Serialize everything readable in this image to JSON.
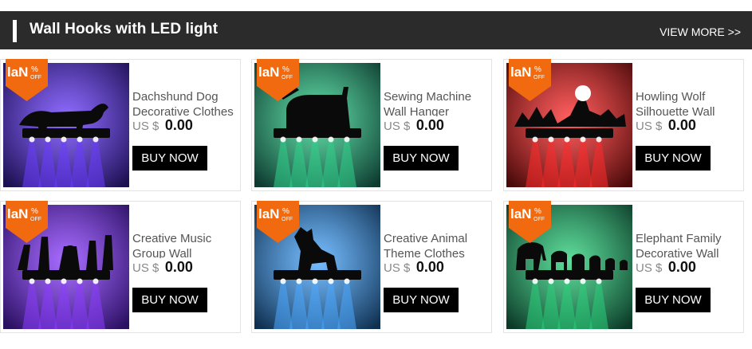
{
  "header": {
    "title": "Wall Hooks with LED light",
    "view_more": "VIEW MORE >>"
  },
  "badge": {
    "brand": "laN",
    "percent": "%",
    "off": "OFF",
    "color": "#f26a10"
  },
  "products": [
    {
      "name": "Dachshund Dog Decorative Clothes",
      "currency": "US $",
      "price": "0.00",
      "buy": "BUY NOW",
      "glow": "#6a3cff",
      "bg": "#1c1050",
      "silhouette": "dog"
    },
    {
      "name": "Sewing Machine Wall Hanger",
      "currency": "US $",
      "price": "0.00",
      "buy": "BUY NOW",
      "glow": "#2fd08a",
      "bg": "#0e3a30",
      "silhouette": "sewing-machine"
    },
    {
      "name": "Howling Wolf Silhouette Wall",
      "currency": "US $",
      "price": "0.00",
      "buy": "BUY NOW",
      "glow": "#ff2a2a",
      "bg": "#4a0a0a",
      "silhouette": "wolf"
    },
    {
      "name": "Creative Music Group Wall",
      "currency": "US $",
      "price": "0.00",
      "buy": "BUY NOW",
      "glow": "#8a3cff",
      "bg": "#2a1060",
      "silhouette": "band"
    },
    {
      "name": "Creative Animal Theme Clothes",
      "currency": "US $",
      "price": "0.00",
      "buy": "BUY NOW",
      "glow": "#4aa8ff",
      "bg": "#103050",
      "silhouette": "dog-sitting"
    },
    {
      "name": "Elephant Family Decorative Wall",
      "currency": "US $",
      "price": "0.00",
      "buy": "BUY NOW",
      "glow": "#2ad07a",
      "bg": "#0c3a28",
      "silhouette": "elephants"
    }
  ]
}
